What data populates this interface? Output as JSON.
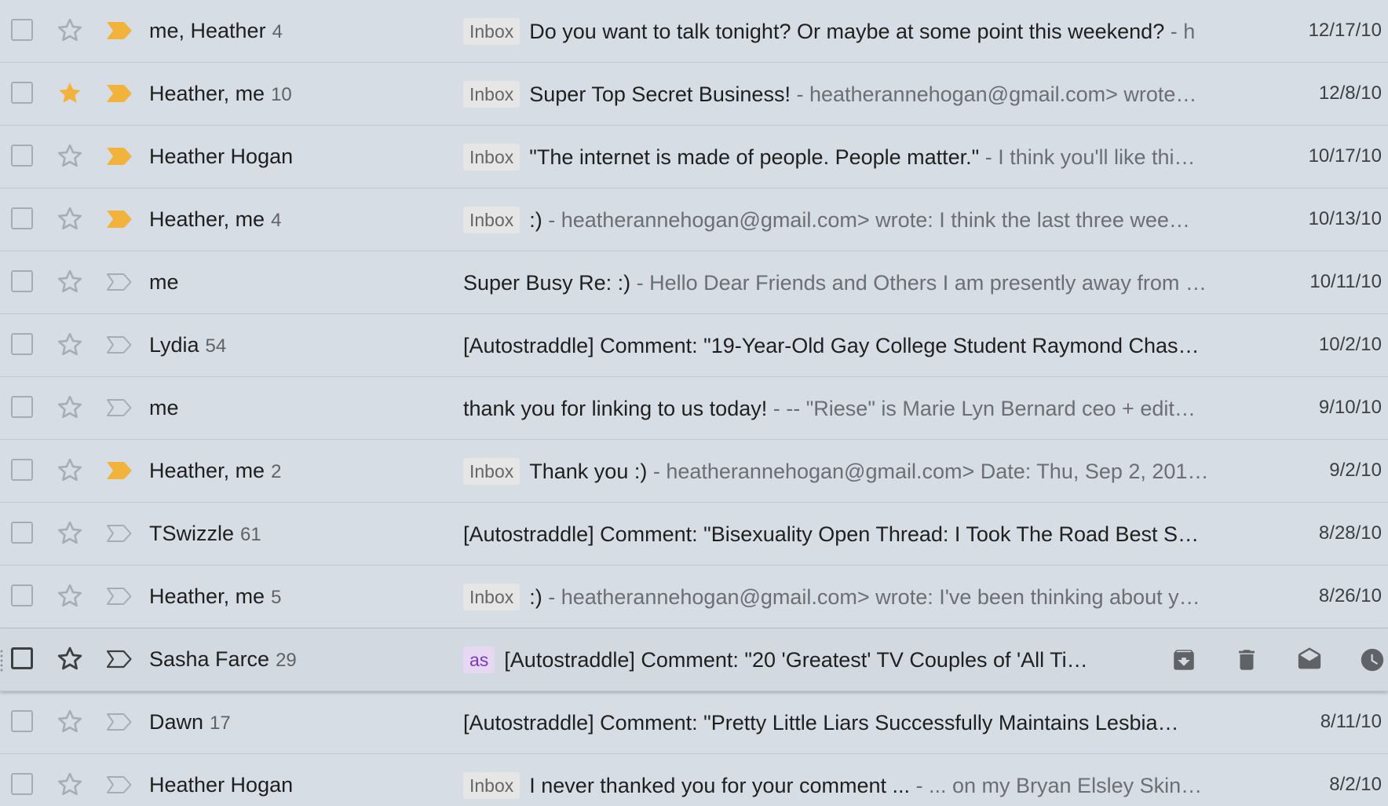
{
  "colors": {
    "background": "#d7dde5",
    "important_marker": "#f2b33d",
    "star_active": "#f2b33d",
    "label_inbox_bg": "#e6e6e6",
    "label_as_bg": "#e6d7f4",
    "label_as_text": "#7a3bb5"
  },
  "emails": [
    {
      "sender": "me, Heather",
      "count": "4",
      "starred": false,
      "important": true,
      "label": "Inbox",
      "subject": "Do you want to talk tonight? Or maybe at some point this weekend?",
      "snippet": " - h",
      "date": "12/17/10"
    },
    {
      "sender": "Heather, me",
      "count": "10",
      "starred": true,
      "important": true,
      "label": "Inbox",
      "subject": "Super Top Secret Business!",
      "snippet": " - heatherannehogan@gmail.com> wrote…",
      "date": "12/8/10"
    },
    {
      "sender": "Heather Hogan",
      "count": "",
      "starred": false,
      "important": true,
      "label": "Inbox",
      "subject": "\"The internet is made of people. People matter.\"",
      "snippet": " - I think you'll like thi…",
      "date": "10/17/10"
    },
    {
      "sender": "Heather, me",
      "count": "4",
      "starred": false,
      "important": true,
      "label": "Inbox",
      "subject": ":)",
      "snippet": " - heatherannehogan@gmail.com> wrote: I think the last three wee…",
      "date": "10/13/10"
    },
    {
      "sender": "me",
      "count": "",
      "starred": false,
      "important": false,
      "label": "",
      "subject": "Super Busy Re: :)",
      "snippet": " - Hello Dear Friends and Others I am presently away from …",
      "date": "10/11/10"
    },
    {
      "sender": "Lydia",
      "count": "54",
      "starred": false,
      "important": false,
      "label": "",
      "subject": "[Autostraddle] Comment: \"19-Year-Old Gay College Student Raymond Chas…",
      "snippet": "",
      "date": "10/2/10"
    },
    {
      "sender": "me",
      "count": "",
      "starred": false,
      "important": false,
      "label": "",
      "subject": "thank you for linking to us today!",
      "snippet": " - -- \"Riese\" is Marie Lyn Bernard ceo + edit…",
      "date": "9/10/10"
    },
    {
      "sender": "Heather, me",
      "count": "2",
      "starred": false,
      "important": true,
      "label": "Inbox",
      "subject": "Thank you :)",
      "snippet": " - heatherannehogan@gmail.com> Date: Thu, Sep 2, 201…",
      "date": "9/2/10"
    },
    {
      "sender": "TSwizzle",
      "count": "61",
      "starred": false,
      "important": false,
      "label": "",
      "subject": "[Autostraddle] Comment: \"Bisexuality Open Thread: I Took The Road Best S…",
      "snippet": "",
      "date": "8/28/10"
    },
    {
      "sender": "Heather, me",
      "count": "5",
      "starred": false,
      "important": false,
      "label": "Inbox",
      "subject": ":)",
      "snippet": " - heatherannehogan@gmail.com> wrote: I've been thinking about y…",
      "date": "8/26/10"
    },
    {
      "sender": "Sasha Farce",
      "count": "29",
      "starred": false,
      "important": false,
      "label": "as",
      "label_style": "purple",
      "subject": "[Autostraddle] Comment: \"20 'Greatest' TV Couples of 'All Ti…",
      "snippet": "",
      "date": "",
      "hovered": true,
      "actions": [
        "archive-icon",
        "trash-icon",
        "mark-read-icon",
        "snooze-icon"
      ]
    },
    {
      "sender": "Dawn",
      "count": "17",
      "starred": false,
      "important": false,
      "label": "",
      "subject": "[Autostraddle] Comment: \"Pretty Little Liars Successfully Maintains Lesbia…",
      "snippet": "",
      "date": "8/11/10"
    },
    {
      "sender": "Heather Hogan",
      "count": "",
      "starred": false,
      "important": false,
      "label": "Inbox",
      "subject": "I never thanked you for your comment ...",
      "snippet": " - ... on my Bryan Elsley Skin…",
      "date": "8/2/10"
    }
  ]
}
